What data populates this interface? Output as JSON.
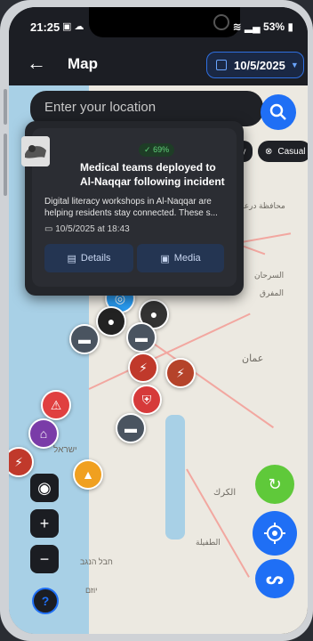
{
  "status_bar": {
    "time": "21:25",
    "battery": "53%"
  },
  "header": {
    "title": "Map",
    "date": "10/5/2025"
  },
  "search": {
    "placeholder": "Enter your location"
  },
  "filter_chip": {
    "label": "Casual"
  },
  "incident_card": {
    "confidence": "69%",
    "title": "Medical teams deployed to Al-Naqqar following incident",
    "description_line1": "Digital literacy workshops in Al-Naqqar are",
    "description_line2": "helping residents stay connected. These s...",
    "timestamp": "10/5/2025 at 18:43",
    "details_label": "Details",
    "media_label": "Media"
  },
  "map_labels": [
    "محافظة درعا",
    "عمان",
    "الكرك",
    "الطفيلة",
    "المفرق",
    "السرحان",
    "ישראל",
    "חבל הנגב",
    "יוזם"
  ],
  "colors": {
    "accent": "#1f6ff5",
    "refresh": "#5fc93a",
    "card_bg": "#24262b"
  }
}
